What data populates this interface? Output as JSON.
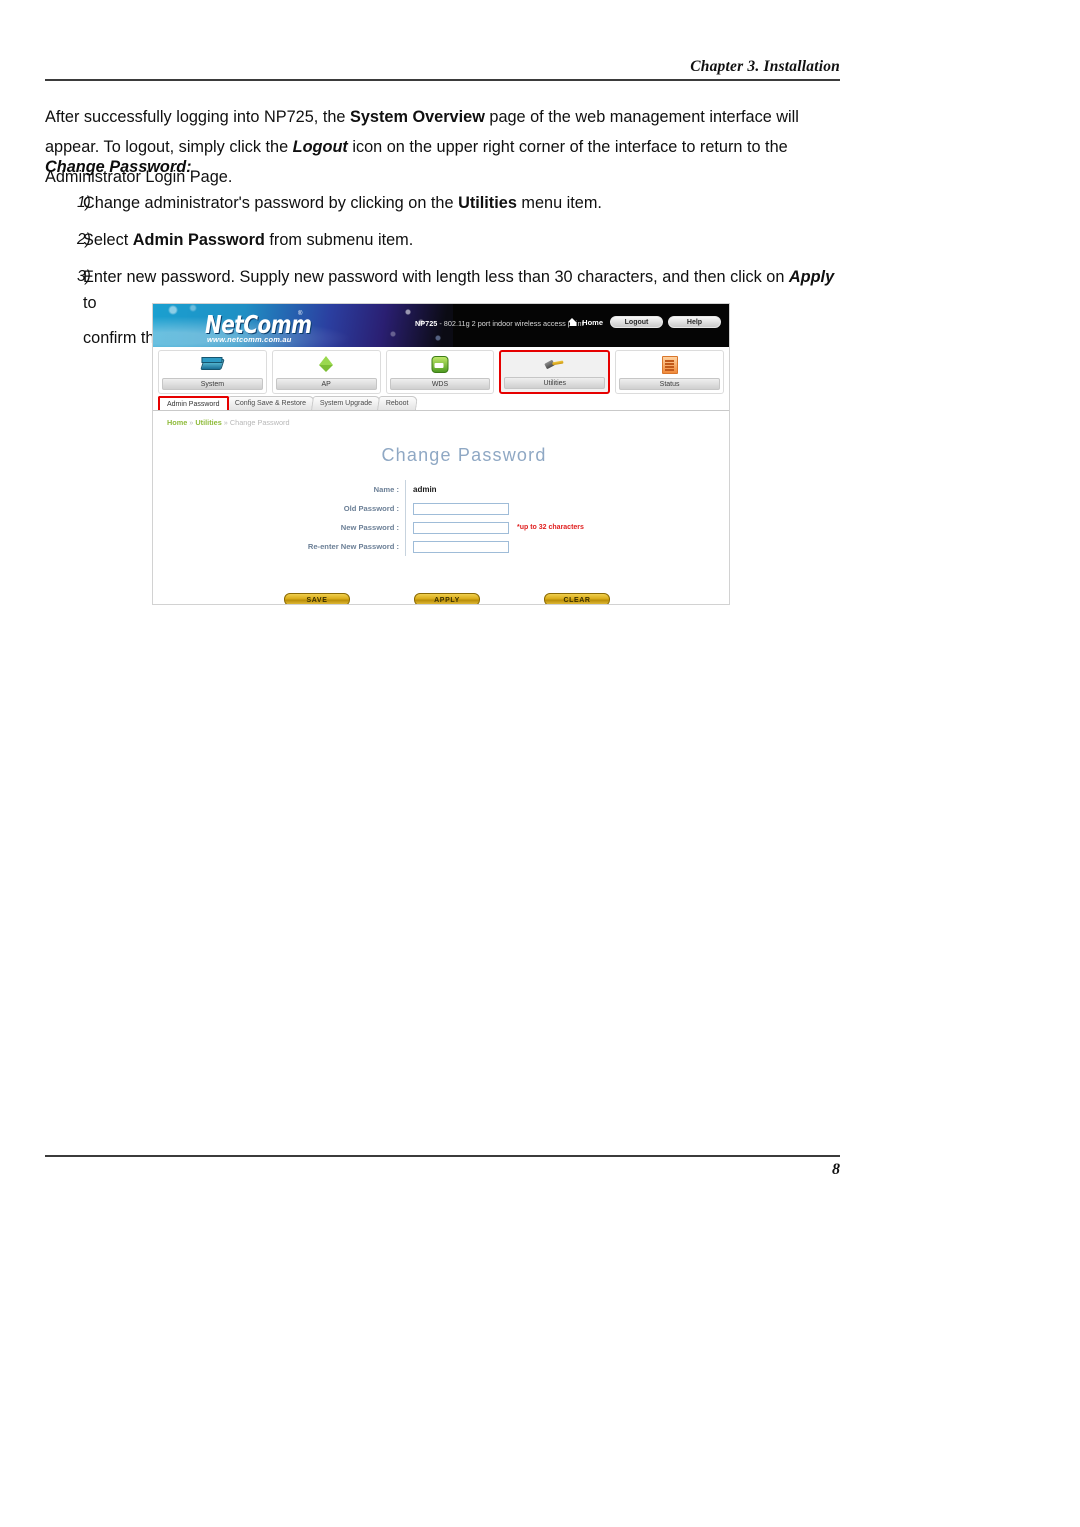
{
  "header": {
    "chapter": "Chapter 3. Installation"
  },
  "intro": {
    "line1_a": "After successfully logging into NP725, the ",
    "line1_b": "System Overview",
    "line1_c": " page of the web management interface will appear. To logout, simply click the ",
    "line1_d": "Logout",
    "line1_e": " icon on the upper right corner of the interface to return to the Administrator Login Page."
  },
  "section": {
    "heading": "Change Password:"
  },
  "steps": [
    {
      "num": "1)",
      "a": "Change administrator's password by clicking on the ",
      "b": "Utilities",
      "c": " menu item."
    },
    {
      "num": "2)",
      "a": "Select ",
      "b": "Admin Password",
      "c": " from submenu item."
    },
    {
      "num": "3)",
      "a": "Enter new password. Supply new password with length less than 30 characters, and then click on ",
      "b": "Apply",
      "c": " to",
      "cont": "confirm the change."
    }
  ],
  "screenshot": {
    "banner": {
      "logo": "NetComm",
      "logo_reg": "®",
      "url": "www.netcomm.com.au",
      "model_name": "NP725",
      "model_desc": " - 802.11g 2 port indoor wireless access point",
      "home_label": "Home",
      "logout_label": "Logout",
      "help_label": "Help"
    },
    "main_tabs": [
      {
        "label": "System",
        "icon": "router-icon",
        "selected": false
      },
      {
        "label": "AP",
        "icon": "antenna-icon",
        "selected": false
      },
      {
        "label": "WDS",
        "icon": "bridge-icon",
        "selected": false
      },
      {
        "label": "Utilities",
        "icon": "hammer-icon",
        "selected": true
      },
      {
        "label": "Status",
        "icon": "document-icon",
        "selected": false
      }
    ],
    "sub_tabs": [
      {
        "label": "Admin Password",
        "selected": true
      },
      {
        "label": "Config Save & Restore",
        "selected": false
      },
      {
        "label": "System Upgrade",
        "selected": false
      },
      {
        "label": "Reboot",
        "selected": false
      }
    ],
    "breadcrumb": {
      "home": "Home",
      "sep1": " » ",
      "section": "Utilities",
      "sep2": " » ",
      "page": "Change Password"
    },
    "pane_title": "Change Password",
    "form": {
      "name_label": "Name :",
      "name_value": "admin",
      "old_label": "Old Password :",
      "old_value": "",
      "new_label": "New Password :",
      "new_value": "",
      "new_hint": "*up to 32 characters",
      "reenter_label": "Re-enter New Password :",
      "reenter_value": ""
    },
    "buttons": {
      "save": "SAVE",
      "apply": "APPLY",
      "clear": "CLEAR"
    },
    "colors": {
      "selected_tab_outline": "#e60000",
      "footer_bar": "#8dc71e",
      "title_text": "#8fa8c4",
      "hint_text": "#e02020",
      "breadcrumb": "#8fbb3a"
    }
  },
  "footer": {
    "page_number": "8"
  }
}
